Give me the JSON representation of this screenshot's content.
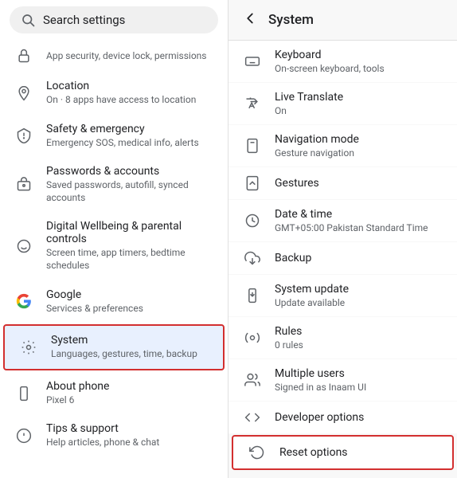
{
  "left": {
    "search": {
      "placeholder": "Search settings"
    },
    "items": [
      {
        "id": "app-security",
        "title": "",
        "subtitle": "App security, device lock, permissions",
        "icon": "lock"
      },
      {
        "id": "location",
        "title": "Location",
        "subtitle": "On · 8 apps have access to location",
        "icon": "location"
      },
      {
        "id": "safety",
        "title": "Safety & emergency",
        "subtitle": "Emergency SOS, medical info, alerts",
        "icon": "safety"
      },
      {
        "id": "passwords",
        "title": "Passwords & accounts",
        "subtitle": "Saved passwords, autofill, synced accounts",
        "icon": "passwords"
      },
      {
        "id": "digital-wellbeing",
        "title": "Digital Wellbeing & parental controls",
        "subtitle": "Screen time, app timers, bedtime schedules",
        "icon": "wellbeing"
      },
      {
        "id": "google",
        "title": "Google",
        "subtitle": "Services & preferences",
        "icon": "google"
      },
      {
        "id": "system",
        "title": "System",
        "subtitle": "Languages, gestures, time, backup",
        "icon": "system",
        "active": true
      },
      {
        "id": "about-phone",
        "title": "About phone",
        "subtitle": "Pixel 6",
        "icon": "phone"
      },
      {
        "id": "tips",
        "title": "Tips & support",
        "subtitle": "Help articles, phone & chat",
        "icon": "tips"
      }
    ]
  },
  "right": {
    "header": {
      "title": "System",
      "back_label": "back"
    },
    "items": [
      {
        "id": "keyboard",
        "title": "Keyboard",
        "subtitle": "On-screen keyboard, tools",
        "icon": "keyboard"
      },
      {
        "id": "live-translate",
        "title": "Live Translate",
        "subtitle": "On",
        "icon": "translate"
      },
      {
        "id": "navigation-mode",
        "title": "Navigation mode",
        "subtitle": "Gesture navigation",
        "icon": "navigation"
      },
      {
        "id": "gestures",
        "title": "Gestures",
        "subtitle": "",
        "icon": "gestures"
      },
      {
        "id": "date-time",
        "title": "Date & time",
        "subtitle": "GMT+05:00 Pakistan Standard Time",
        "icon": "clock"
      },
      {
        "id": "backup",
        "title": "Backup",
        "subtitle": "",
        "icon": "backup"
      },
      {
        "id": "system-update",
        "title": "System update",
        "subtitle": "Update available",
        "icon": "system-update"
      },
      {
        "id": "rules",
        "title": "Rules",
        "subtitle": "0 rules",
        "icon": "rules"
      },
      {
        "id": "multiple-users",
        "title": "Multiple users",
        "subtitle": "Signed in as Inaam UI",
        "icon": "users"
      },
      {
        "id": "developer-options",
        "title": "Developer options",
        "subtitle": "",
        "icon": "developer"
      },
      {
        "id": "reset-options",
        "title": "Reset options",
        "subtitle": "",
        "icon": "reset",
        "highlighted": true
      }
    ]
  }
}
